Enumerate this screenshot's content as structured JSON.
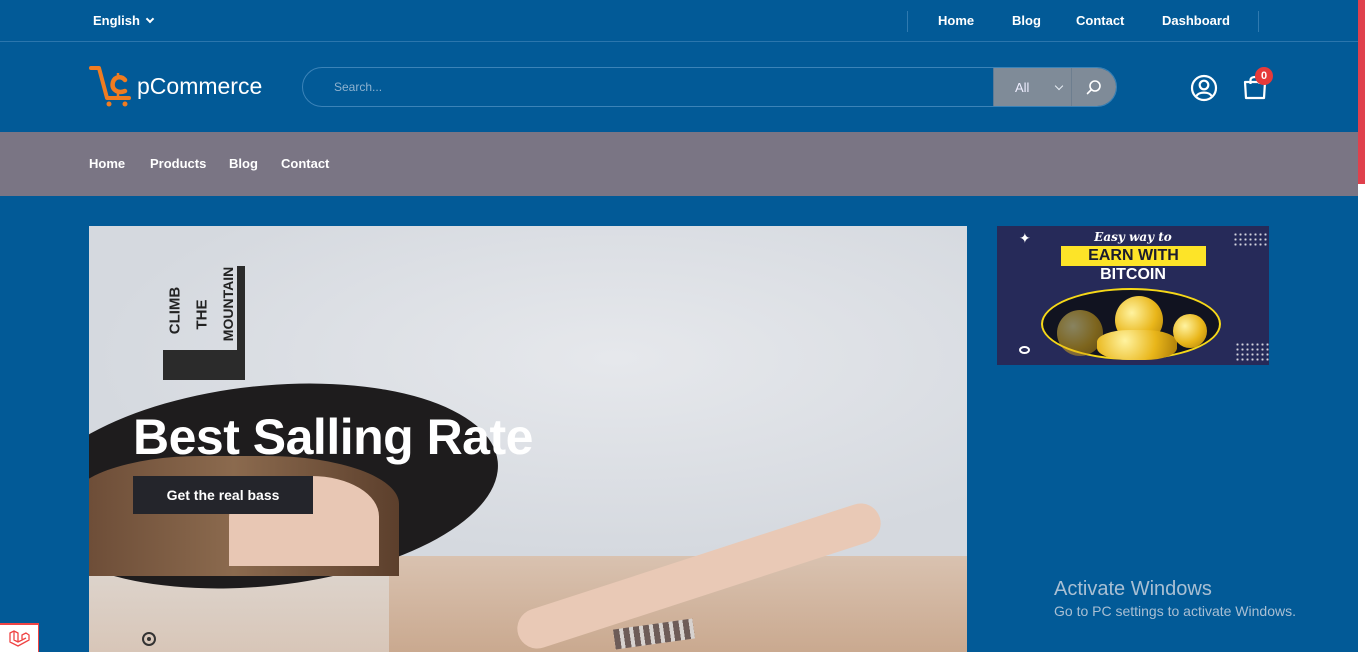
{
  "topbar": {
    "language": "English",
    "links": [
      "Home",
      "Blog",
      "Contact",
      "Dashboard"
    ]
  },
  "header": {
    "logo_text": "pCommerce",
    "search": {
      "placeholder": "Search...",
      "category": "All"
    },
    "cart_count": "0"
  },
  "nav": {
    "items": [
      "Home",
      "Products",
      "Blog",
      "Contact"
    ]
  },
  "hero": {
    "poster_text": [
      "CLIMB",
      "THE",
      "MOUNTAIN"
    ],
    "title": "Best Salling Rate",
    "button_label": "Get the real bass"
  },
  "banner": {
    "line1": "Easy way to",
    "line2": "EARN WITH",
    "line3": "BITCOIN"
  },
  "watermark": {
    "title": "Activate Windows",
    "subtitle": "Go to PC settings to activate Windows."
  },
  "colors": {
    "page_bg": "#025a97",
    "nav_bg": "#7a7584",
    "badge": "#e63a3a",
    "logo_accent": "#f07c21",
    "banner_yellow": "#fde428"
  }
}
